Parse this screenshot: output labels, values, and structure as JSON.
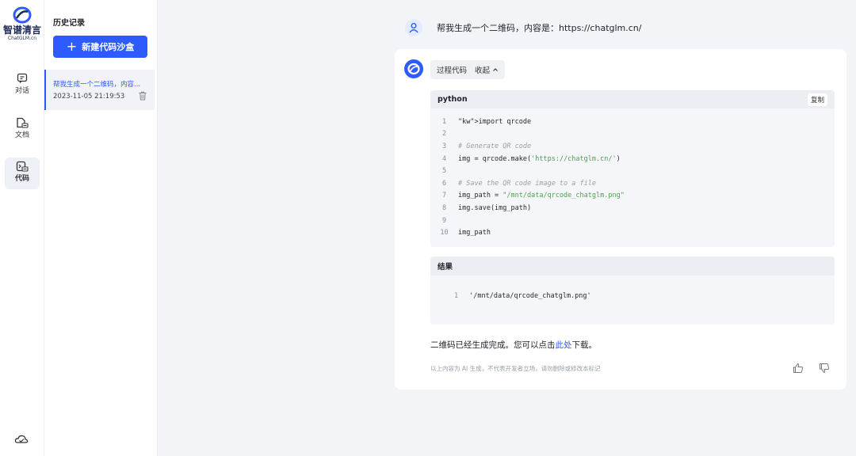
{
  "app": {
    "brand_name": "智谱清言",
    "brand_sub": "ChatGLM.cn"
  },
  "rail": {
    "items": [
      {
        "label": "对话",
        "icon": "chat-icon"
      },
      {
        "label": "文档",
        "icon": "document-icon"
      },
      {
        "label": "代码",
        "icon": "code-icon"
      }
    ]
  },
  "history": {
    "title": "历史记录",
    "new_button_label": "新建代码沙盒",
    "items": [
      {
        "title": "帮我生成一个二维码，内容...",
        "datetime": "2023-11-05 21:19:53"
      }
    ]
  },
  "chat": {
    "user_message": "帮我生成一个二维码，内容是：https://chatglm.cn/",
    "process_label": "过程代码",
    "collapse_label": "收起",
    "code": {
      "language": "python",
      "copy_label": "复制",
      "lines": [
        {
          "n": "1",
          "text": "import qrcode"
        },
        {
          "n": "2",
          "text": ""
        },
        {
          "n": "3",
          "text": "# Generate QR code"
        },
        {
          "n": "4",
          "text": "img = qrcode.make('https://chatglm.cn/')"
        },
        {
          "n": "5",
          "text": ""
        },
        {
          "n": "6",
          "text": "# Save the QR code image to a file"
        },
        {
          "n": "7",
          "text": "img_path = \"/mnt/data/qrcode_chatglm.png\""
        },
        {
          "n": "8",
          "text": "img.save(img_path)"
        },
        {
          "n": "9",
          "text": ""
        },
        {
          "n": "10",
          "text": "img_path"
        }
      ]
    },
    "result": {
      "title": "结果",
      "line_number": "1",
      "value": "'/mnt/data/qrcode_chatglm.png'"
    },
    "answer_prefix": "二维码已经生成完成。您可以点击",
    "answer_link": "此处",
    "answer_suffix": "下载。",
    "disclaimer": "以上内容为 AI 生成，不代表开发者立场，请勿删除或修改本标记"
  },
  "colors": {
    "accent": "#2d5bff",
    "brand_dark": "#1c2a55"
  }
}
